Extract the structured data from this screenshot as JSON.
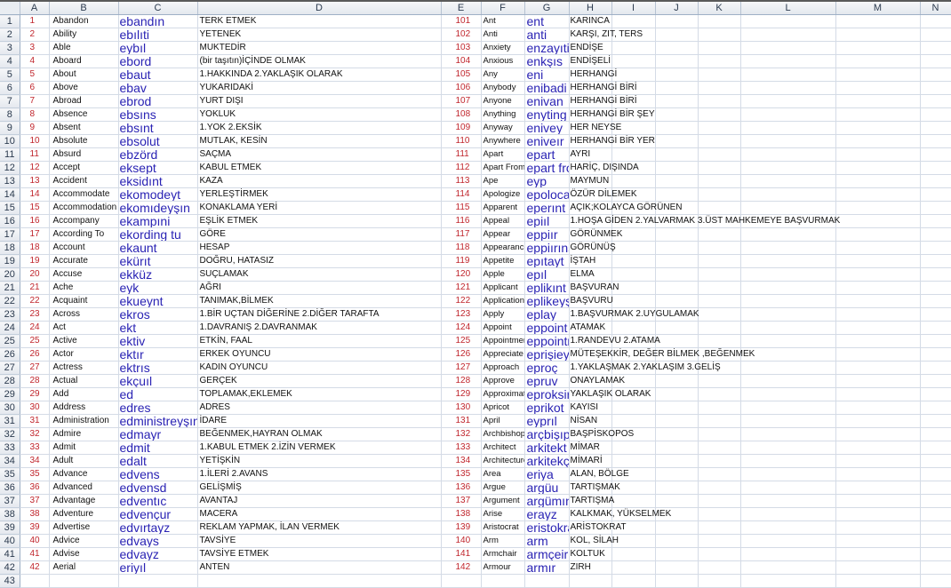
{
  "colors": {
    "number": "#c0262d",
    "pronunciation": "#2a23b4",
    "text": "#111111",
    "gridline": "#d4dbe6"
  },
  "columns": [
    "A",
    "B",
    "C",
    "D",
    "E",
    "F",
    "G",
    "H",
    "I",
    "J",
    "K",
    "L",
    "M",
    "N"
  ],
  "left": [
    [
      "1",
      "Abandon",
      "ebandın",
      "TERK ETMEK"
    ],
    [
      "2",
      "Ability",
      "ebılıti",
      "YETENEK"
    ],
    [
      "3",
      "Able",
      "eybıl",
      "MUKTEDİR"
    ],
    [
      "4",
      "Aboard",
      "ebord",
      "(bir taşıtın)İÇİNDE OLMAK"
    ],
    [
      "5",
      "About",
      "ebaut",
      "1.HAKKINDA 2.YAKLAŞIK OLARAK"
    ],
    [
      "6",
      "Above",
      "ebav",
      "YUKARIDAKİ"
    ],
    [
      "7",
      "Abroad",
      "ebrod",
      "YURT DIŞI"
    ],
    [
      "8",
      "Absence",
      "ebsıns",
      "YOKLUK"
    ],
    [
      "9",
      "Absent",
      "ebsınt",
      "1.YOK 2.EKSİK"
    ],
    [
      "10",
      "Absolute",
      "ebsolut",
      "MUTLAK, KESİN"
    ],
    [
      "11",
      "Absurd",
      "ebzörd",
      "SAÇMA"
    ],
    [
      "12",
      "Accept",
      "eksept",
      "KABUL ETMEK"
    ],
    [
      "13",
      "Accident",
      "eksidınt",
      "KAZA"
    ],
    [
      "14",
      "Accommodate",
      "ekomodeyt",
      "YERLEŞTİRMEK"
    ],
    [
      "15",
      "Accommodation",
      "ekomıdeyşın",
      "KONAKLAMA YERİ"
    ],
    [
      "16",
      "Accompany",
      "ekampıni",
      "EŞLİK ETMEK"
    ],
    [
      "17",
      "According To",
      "ekording tu",
      "GÖRE"
    ],
    [
      "18",
      "Account",
      "ekaunt",
      "HESAP"
    ],
    [
      "19",
      "Accurate",
      "ekürıt",
      "DOĞRU, HATASIZ"
    ],
    [
      "20",
      "Accuse",
      "ekküz",
      "SUÇLAMAK"
    ],
    [
      "21",
      "Ache",
      "eyk",
      "AĞRI"
    ],
    [
      "22",
      "Acquaint",
      "ekueynt",
      "TANIMAK,BİLMEK"
    ],
    [
      "23",
      "Across",
      "ekros",
      "1.BİR UÇTAN DİĞERİNE  2.DİĞER TARAFTA"
    ],
    [
      "24",
      "Act",
      "ekt",
      "1.DAVRANIŞ  2.DAVRANMAK"
    ],
    [
      "25",
      "Active",
      "ektiv",
      "ETKİN, FAAL"
    ],
    [
      "26",
      "Actor",
      "ektır",
      "ERKEK OYUNCU"
    ],
    [
      "27",
      "Actress",
      "ektrıs",
      "KADIN OYUNCU"
    ],
    [
      "28",
      "Actual",
      "ekçuıl",
      "GERÇEK"
    ],
    [
      "29",
      "Add",
      "ed",
      "TOPLAMAK,EKLEMEK"
    ],
    [
      "30",
      "Address",
      "edres",
      "ADRES"
    ],
    [
      "31",
      "Administration",
      "edministreyşın",
      " İDARE"
    ],
    [
      "32",
      "Admire",
      "edmayr",
      "BEĞENMEK,HAYRAN OLMAK"
    ],
    [
      "33",
      "Admit",
      "edmit",
      "1.KABUL ETMEK  2.İZİN VERMEK"
    ],
    [
      "34",
      "Adult",
      "edalt",
      "YETİŞKİN"
    ],
    [
      "35",
      "Advance",
      "edvens",
      "1.İLERİ 2.AVANS"
    ],
    [
      "36",
      "Advanced",
      "edvensd",
      "GELİŞMİŞ"
    ],
    [
      "37",
      "Advantage",
      "edventıc",
      "AVANTAJ"
    ],
    [
      "38",
      "Adventure",
      "edvençur",
      "MACERA"
    ],
    [
      "39",
      "Advertise",
      "edvırtayz",
      "REKLAM YAPMAK, İLAN VERMEK"
    ],
    [
      "40",
      "Advice",
      "edvays",
      "TAVSİYE"
    ],
    [
      "41",
      "Advise",
      "edvayz",
      "TAVSİYE ETMEK"
    ],
    [
      "42",
      "Aerial",
      "eriyıl",
      "ANTEN"
    ]
  ],
  "right": [
    [
      "101",
      "Ant",
      "ent",
      "KARINCA"
    ],
    [
      "102",
      "Anti",
      "anti",
      "KARŞI, ZIT, TERS"
    ],
    [
      "103",
      "Anxiety",
      "enzayıti",
      "ENDİŞE"
    ],
    [
      "104",
      "Anxious",
      "enkşıs",
      "ENDİŞELİ"
    ],
    [
      "105",
      "Any",
      "eni",
      "HERHANGİ"
    ],
    [
      "106",
      "Anybody",
      "enibadi",
      "HERHANGİ BİRİ"
    ],
    [
      "107",
      "Anyone",
      "enivan",
      "HERHANGİ BİRİ"
    ],
    [
      "108",
      "Anything",
      "enyting",
      "HERHANGİ BİR ŞEY"
    ],
    [
      "109",
      "Anyway",
      "enivey",
      "HER NEYSE"
    ],
    [
      "110",
      "Anywhere",
      "eniveır",
      "HERHANGİ BİR YER"
    ],
    [
      "111",
      "Apart",
      "epart",
      "AYRI"
    ],
    [
      "112",
      "Apart From",
      "epart fro",
      "HARİÇ, DIŞINDA"
    ],
    [
      "113",
      "Ape",
      "eyp",
      "MAYMUN"
    ],
    [
      "114",
      "Apologize",
      "epoloca",
      "ÖZÜR DİLEMEK"
    ],
    [
      "115",
      "Apparent",
      "eperınt",
      "AÇIK;KOLAYCA GÖRÜNEN"
    ],
    [
      "116",
      "Appeal",
      "epiıl",
      "1.HOŞA GİDEN 2.YALVARMAK 3.ÜST MAHKEMEYE BAŞVURMAK"
    ],
    [
      "117",
      "Appear",
      "eppiır",
      "GÖRÜNMEK"
    ],
    [
      "118",
      "Appearance",
      "eppiırıns",
      "GÖRÜNÜŞ"
    ],
    [
      "119",
      "Appetite",
      "epıtayt",
      "İŞTAH"
    ],
    [
      "120",
      "Apple",
      "epıl",
      "ELMA"
    ],
    [
      "121",
      "Applicant",
      "eplikınt",
      "BAŞVURAN"
    ],
    [
      "122",
      "Application",
      "eplikeyş",
      "BAŞVURU"
    ],
    [
      "123",
      "Apply",
      "eplay",
      "1.BAŞVURMAK 2.UYGULAMAK"
    ],
    [
      "124",
      "Appoint",
      "eppoint",
      "ATAMAK"
    ],
    [
      "125",
      "Appointment",
      "eppointr",
      "1.RANDEVU 2.ATAMA"
    ],
    [
      "126",
      "Appreciate",
      "eprişieyt",
      "MÜTEŞEKKİR, DEĞER BİLMEK ,BEĞENMEK"
    ],
    [
      "127",
      "Approach",
      "eproç",
      "1.YAKLAŞMAK 2.YAKLAŞIM 3.GELİŞ"
    ],
    [
      "128",
      "Approve",
      "epruv",
      "ONAYLAMAK"
    ],
    [
      "129",
      "Approximate",
      "eproksir",
      "YAKLAŞIK OLARAK"
    ],
    [
      "130",
      "Apricot",
      "eprikot",
      "KAYISI"
    ],
    [
      "131",
      "April",
      "eyprıl",
      "NİSAN"
    ],
    [
      "132",
      "Archbishop",
      "arçbişıp",
      "BAŞPİSKOPOS"
    ],
    [
      "133",
      "Architect",
      "arkitekt",
      "MİMAR"
    ],
    [
      "134",
      "Architecture",
      "arkitekçı",
      "MİMARİ"
    ],
    [
      "135",
      "Area",
      "eriya",
      "ALAN, BÖLGE"
    ],
    [
      "136",
      "Argue",
      "argüu",
      "TARTIŞMAK"
    ],
    [
      "137",
      "Argument",
      "argümın",
      "TARTIŞMA"
    ],
    [
      "138",
      "Arise",
      "erayz",
      "KALKMAK, YÜKSELMEK"
    ],
    [
      "139",
      "Aristocrat",
      "eristokra",
      "ARİSTOKRAT"
    ],
    [
      "140",
      "Arm",
      "arm",
      "KOL, SİLAH"
    ],
    [
      "141",
      "Armchair",
      "armçeir",
      "KOLTUK"
    ],
    [
      "142",
      "Armour",
      "armır",
      "ZIRH"
    ]
  ]
}
